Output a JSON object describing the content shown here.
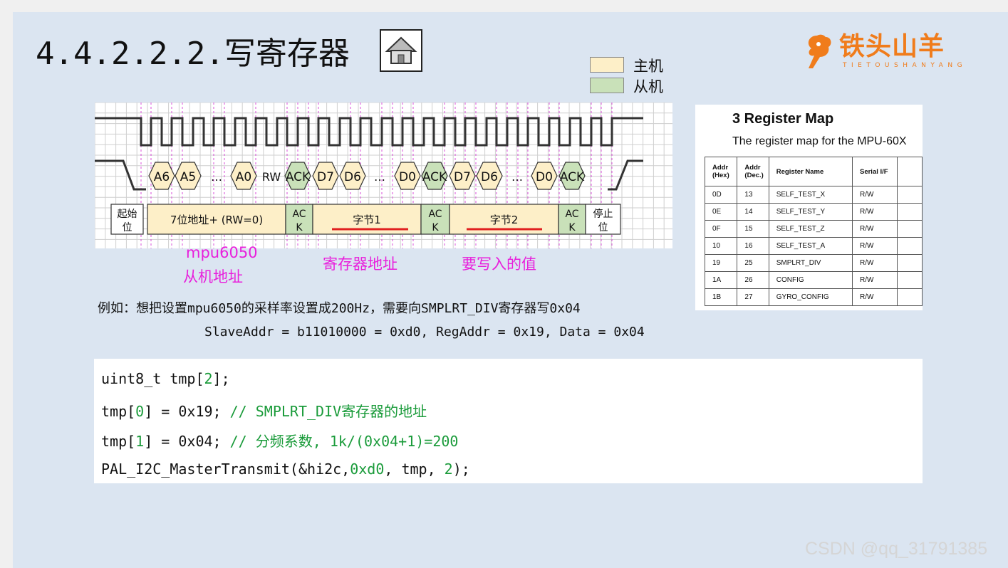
{
  "title": "4.4.2.2.2.写寄存器",
  "legend": {
    "master_label": "主机",
    "slave_label": "从机",
    "master_color": "#fdefc8",
    "slave_color": "#c9e1b9"
  },
  "logo": {
    "cn": "铁头山羊",
    "en": "TIETOUSHANYANG",
    "color": "#f07c1b"
  },
  "timing": {
    "sda_symbols": [
      "A6",
      "A5",
      "…",
      "A0",
      "RW",
      "ACK",
      "D7",
      "D6",
      "…",
      "D0",
      "ACK",
      "D7",
      "D6",
      "…",
      "D0",
      "ACK"
    ],
    "segments": [
      "起始位",
      "7位地址+ (RW=0)",
      "ACK",
      "字节1",
      "ACK",
      "字节2",
      "ACK",
      "停止位"
    ]
  },
  "annotations": {
    "slave_addr_line1": "mpu6050",
    "slave_addr_line2": "从机地址",
    "reg_addr": "寄存器地址",
    "value": "要写入的值"
  },
  "example": {
    "line1": "例如：想把设置mpu6050的采样率设置成200Hz，需要向SMPLRT_DIV寄存器写0x04",
    "line2": "SlaveAddr = b11010000 = 0xd0, RegAddr = 0x19, Data = 0x04"
  },
  "regmap": {
    "heading": "3    Register Map",
    "subtitle": "The register map for the MPU-60X",
    "headers": [
      "Addr (Hex)",
      "Addr (Dec.)",
      "Register Name",
      "Serial I/F"
    ],
    "rows": [
      [
        "0D",
        "13",
        "SELF_TEST_X",
        "R/W"
      ],
      [
        "0E",
        "14",
        "SELF_TEST_Y",
        "R/W"
      ],
      [
        "0F",
        "15",
        "SELF_TEST_Z",
        "R/W"
      ],
      [
        "10",
        "16",
        "SELF_TEST_A",
        "R/W"
      ],
      [
        "19",
        "25",
        "SMPLRT_DIV",
        "R/W"
      ],
      [
        "1A",
        "26",
        "CONFIG",
        "R/W"
      ],
      [
        "1B",
        "27",
        "GYRO_CONFIG",
        "R/W"
      ]
    ]
  },
  "code": {
    "l1": {
      "a": "uint8_t tmp[",
      "n": "2",
      "b": "];"
    },
    "l2": {
      "a": "tmp[",
      "n": "0",
      "b": "] = 0x19; ",
      "c": "// SMPLRT_DIV寄存器的地址"
    },
    "l3": {
      "a": "tmp[",
      "n": "1",
      "b": "] = 0x04; ",
      "c": "// 分频系数, 1k/(0x04+1)=200"
    },
    "l4": {
      "a": "PAL_I2C_MasterTransmit(&hi2c,",
      "n1": "0xd0",
      "b": ", tmp, ",
      "n2": "2",
      "c": ");"
    }
  },
  "watermark": "CSDN @qq_31791385"
}
